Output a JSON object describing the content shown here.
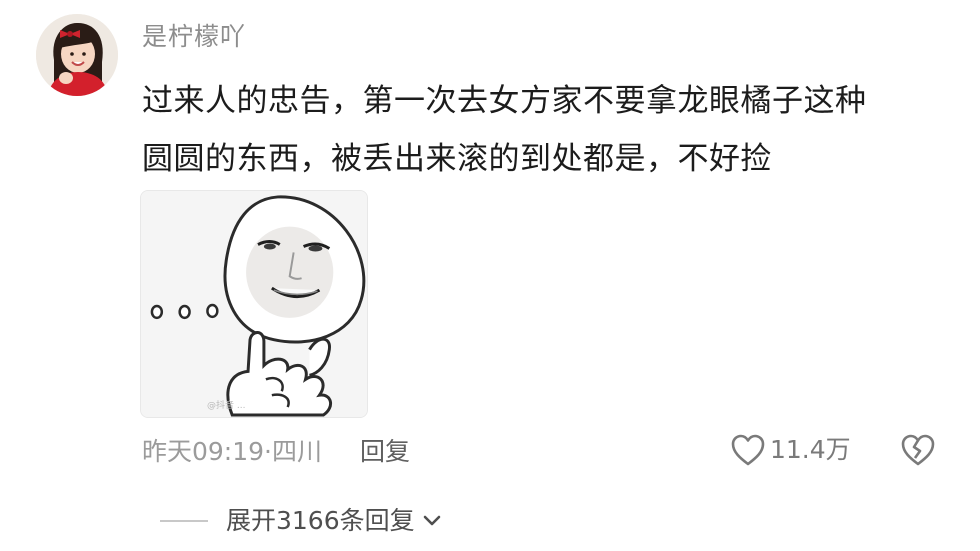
{
  "comment": {
    "username": "是柠檬吖",
    "content_lines": [
      "过来人的忠告，第一次去女方家不要拿龙眼橘子这种",
      "圆圆的东西，被丢出来滚的到处都是，不好捡"
    ],
    "sticker": {
      "icon": "smiling-face-meme-sticker",
      "watermark": "@抖音 ..."
    },
    "time": "昨天09:19",
    "separator": " · ",
    "location": "四川",
    "reply_label": "回复",
    "like_count": "11.4万",
    "expand_label": "展开3166条回复"
  },
  "icons": {
    "like": "heart-outline-icon",
    "dislike": "broken-heart-icon",
    "expand": "chevron-down-icon"
  },
  "colors": {
    "text_primary": "#1c1c1c",
    "text_muted": "#9b9b9b",
    "username": "#8d8d8d",
    "icon": "#7a7a7a"
  }
}
